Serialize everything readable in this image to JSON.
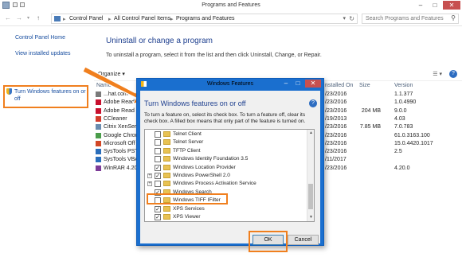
{
  "window": {
    "title": "Programs and Features"
  },
  "breadcrumb": [
    "Control Panel",
    "All Control Panel Items",
    "Programs and Features"
  ],
  "search": {
    "placeholder": "Search Programs and Features"
  },
  "left_pane": {
    "home": "Control Panel Home",
    "updates": "View installed updates",
    "features": "Turn Windows features on or off"
  },
  "main": {
    "title": "Uninstall or change a program",
    "description": "To uninstall a program, select it from the list and then click Uninstall, Change, or Repair.",
    "organize": "Organize ▾"
  },
  "columns": {
    "name": "Name",
    "installed": "nstalled On",
    "size": "Size",
    "version": "Version"
  },
  "programs": [
    {
      "name": "...hat.com",
      "date": "/23/2016",
      "size": "",
      "version": "1.1.377",
      "color": "#7a7a7a"
    },
    {
      "name": "Adobe Read",
      "date": "/23/2016",
      "size": "",
      "version": "1.0.4990",
      "color": "#c8102e"
    },
    {
      "name": "Adobe Read",
      "date": "/23/2016",
      "size": "204 MB",
      "version": "9.0.0",
      "color": "#c8102e"
    },
    {
      "name": "CCleaner",
      "date": "/19/2013",
      "size": "",
      "version": "4.03",
      "color": "#d33c2c"
    },
    {
      "name": "Citrix XenServ",
      "date": "/23/2016",
      "size": "7.85 MB",
      "version": "7.0.783",
      "color": "#6a8caf"
    },
    {
      "name": "Google Chrom",
      "date": "/23/2016",
      "size": "",
      "version": "61.0.3163.100",
      "color": "#4a9d4a"
    },
    {
      "name": "Microsoft Off",
      "date": "/23/2016",
      "size": "",
      "version": "15.0.4420.1017",
      "color": "#d24726"
    },
    {
      "name": "SysTools PST",
      "date": "/23/2016",
      "size": "",
      "version": "2.5",
      "color": "#2a6ebb"
    },
    {
      "name": "SysTools VBA",
      "date": "/11/2017",
      "size": "",
      "version": "",
      "color": "#2a6ebb"
    },
    {
      "name": "WinRAR 4.20",
      "date": "/23/2016",
      "size": "",
      "version": "4.20.0",
      "color": "#7d3c98"
    }
  ],
  "dialog": {
    "title": "Windows Features",
    "heading": "Turn Windows features on or off",
    "description": "To turn a feature on, select its check box. To turn a feature off, clear its check box. A filled box means that only part of the feature is turned on.",
    "features": [
      {
        "label": "Telnet Client",
        "state": "unchecked",
        "expand": ""
      },
      {
        "label": "Telnet Server",
        "state": "unchecked",
        "expand": ""
      },
      {
        "label": "TFTP Client",
        "state": "unchecked",
        "expand": ""
      },
      {
        "label": "Windows Identity Foundation 3.5",
        "state": "unchecked",
        "expand": ""
      },
      {
        "label": "Windows Location Provider",
        "state": "checked",
        "expand": ""
      },
      {
        "label": "Windows PowerShell 2.0",
        "state": "checked",
        "expand": "+"
      },
      {
        "label": "Windows Process Activation Service",
        "state": "unchecked",
        "expand": "+"
      },
      {
        "label": "Windows Search",
        "state": "checked",
        "expand": ""
      },
      {
        "label": "Windows TIFF IFilter",
        "state": "unchecked",
        "expand": ""
      },
      {
        "label": "XPS Services",
        "state": "checked",
        "expand": ""
      },
      {
        "label": "XPS Viewer",
        "state": "checked",
        "expand": ""
      }
    ],
    "ok": "OK",
    "cancel": "Cancel"
  },
  "highlight_color": "#f07f1e",
  "icons": [
    "back-icon",
    "forward-icon",
    "up-icon",
    "control-panel-icon",
    "refresh-icon",
    "search-icon",
    "shield-icon",
    "help-icon",
    "folder-icon"
  ]
}
